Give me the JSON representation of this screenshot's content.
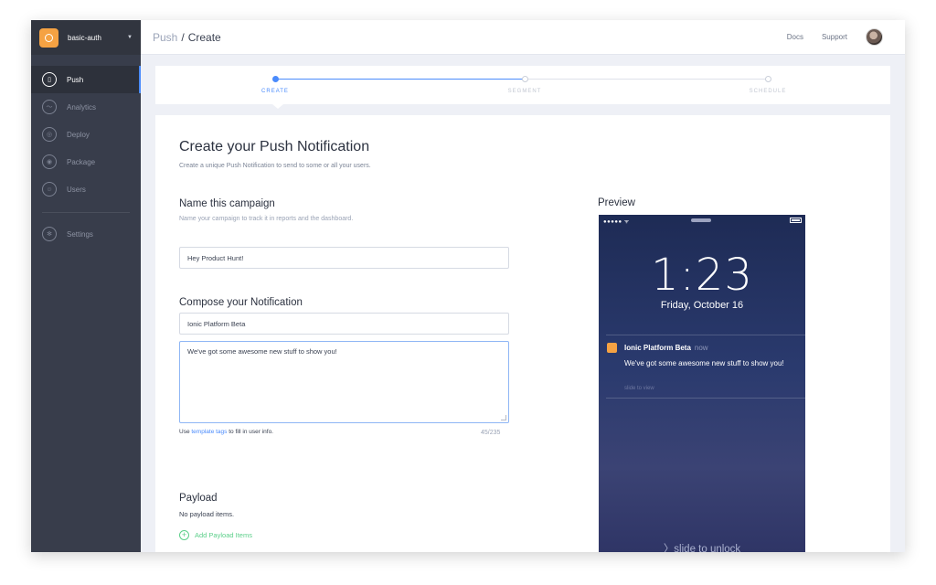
{
  "app": {
    "name": "basic-auth"
  },
  "sidebar": {
    "items": [
      {
        "label": "Push",
        "icon": "phone-icon",
        "active": true
      },
      {
        "label": "Analytics",
        "icon": "analytics-icon",
        "active": false
      },
      {
        "label": "Deploy",
        "icon": "deploy-icon",
        "active": false
      },
      {
        "label": "Package",
        "icon": "package-icon",
        "active": false
      },
      {
        "label": "Users",
        "icon": "users-icon",
        "active": false
      }
    ],
    "settings": {
      "label": "Settings",
      "icon": "gear-icon"
    }
  },
  "header": {
    "breadcrumb_parent": "Push",
    "breadcrumb_sep": "/",
    "breadcrumb_current": "Create",
    "links": {
      "docs": "Docs",
      "support": "Support"
    }
  },
  "stepper": {
    "steps": [
      {
        "label": "CREATE",
        "state": "active"
      },
      {
        "label": "SEGMENT",
        "state": "todo"
      },
      {
        "label": "SCHEDULE",
        "state": "todo"
      }
    ]
  },
  "form": {
    "title": "Create your Push Notification",
    "subtitle": "Create a unique Push Notification to send to some or all your users.",
    "campaign": {
      "title": "Name this campaign",
      "subtitle": "Name your campaign to track it in reports and the dashboard.",
      "value": "Hey Product Hunt!"
    },
    "compose": {
      "title": "Compose your Notification",
      "title_value": "Ionic Platform Beta",
      "message_value": "We've got some awesome new stuff to show you!",
      "hint_prefix": "Use ",
      "hint_link": "template tags",
      "hint_suffix": " to fill in user info.",
      "counter": "45/235"
    },
    "payload": {
      "title": "Payload",
      "empty": "No payload items.",
      "add_label": "Add Payload Items"
    }
  },
  "preview": {
    "title": "Preview",
    "signal": "●●●●● ᯤ",
    "time": "1:23",
    "date": "Friday, October 16",
    "notification": {
      "app": "Ionic Platform Beta",
      "time": "now",
      "body": "We've got some awesome new stuff to show you!",
      "slide": "slide to view"
    },
    "unlock": "〉slide to unlock"
  },
  "colors": {
    "accent": "#4a8bfc",
    "sidebar": "#383d4b",
    "brand_orange": "#f5a243",
    "add_green": "#5ccf8a"
  }
}
